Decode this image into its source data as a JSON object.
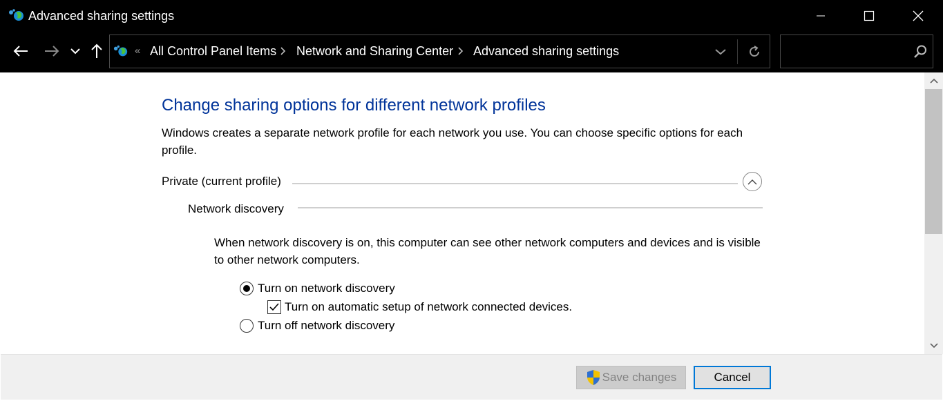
{
  "window": {
    "title": "Advanced sharing settings"
  },
  "address_bar": {
    "overflow_chevron": "«",
    "breadcrumbs": [
      "All Control Panel Items",
      "Network and Sharing Center",
      "Advanced sharing settings"
    ]
  },
  "search": {
    "placeholder": ""
  },
  "content": {
    "title": "Change sharing options for different network profiles",
    "description": "Windows creates a separate network profile for each network you use. You can choose specific options for each profile.",
    "profile": {
      "label": "Private (current profile)",
      "expanded": true
    },
    "network_discovery": {
      "label": "Network discovery",
      "info": "When network discovery is on, this computer can see other network computers and devices and is visible to other network computers.",
      "options": [
        {
          "label": "Turn on network discovery",
          "selected": true
        },
        {
          "label": "Turn off network discovery",
          "selected": false
        }
      ],
      "auto_setup": {
        "label": "Turn on automatic setup of network connected devices.",
        "checked": true
      }
    }
  },
  "footer": {
    "save_label": "Save changes",
    "cancel_label": "Cancel"
  },
  "colors": {
    "title_blue": "#003399",
    "focus_blue": "#0078d7",
    "chrome_black": "#000000"
  },
  "icons": {
    "app": "network-globe-icon",
    "shield": "uac-shield-icon"
  }
}
